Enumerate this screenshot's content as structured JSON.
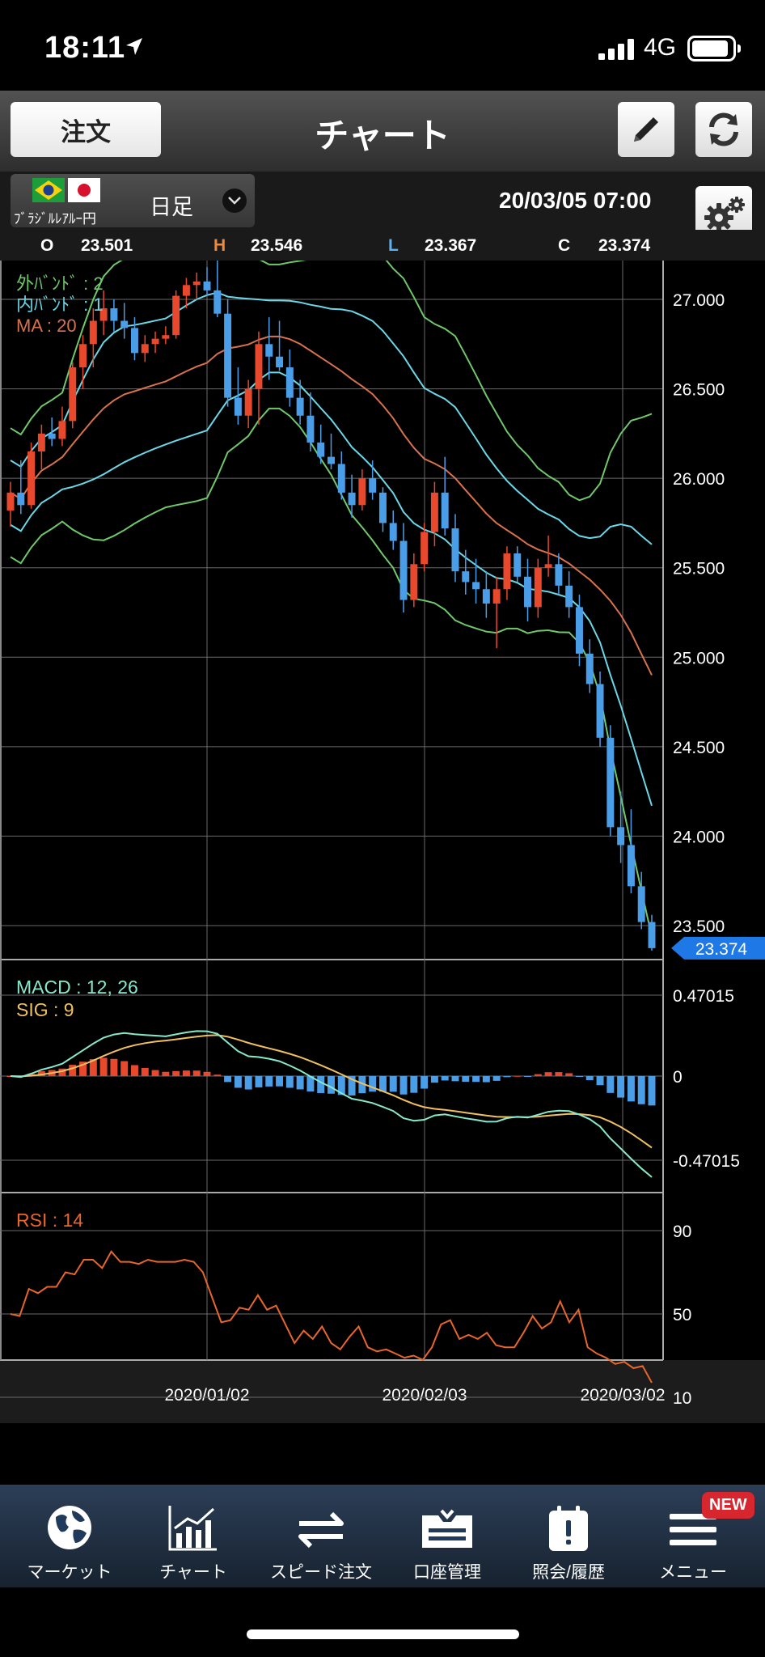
{
  "status_bar": {
    "time": "18:11",
    "network": "4G"
  },
  "toolbar": {
    "order_label": "注文",
    "title": "チャート"
  },
  "symbol": {
    "name": "ﾌﾞﾗｼﾞﾙﾚｱﾙｰ円",
    "period": "日足",
    "datetime": "20/03/05  07:00"
  },
  "ohlc": {
    "o_label": "O",
    "o_value": "23.501",
    "h_label": "H",
    "h_value": "23.546",
    "l_label": "L",
    "l_value": "23.367",
    "c_label": "C",
    "c_value": "23.374"
  },
  "colors": {
    "up": "#e8482c",
    "down": "#4a9ee8",
    "outer_band": "#6fc86a",
    "inner_band": "#6ad8e8",
    "ma": "#d8714e",
    "macd": "#88e8cc",
    "signal": "#f0c060",
    "rsi": "#e8652c",
    "grid": "#6a6a6a",
    "price_tag": "#1e78e6"
  },
  "chart_data": [
    {
      "type": "candlestick",
      "ylim": [
        23.374,
        27.2
      ],
      "y_ticks": [
        "27.000",
        "26.500",
        "26.000",
        "25.500",
        "25.000",
        "24.500",
        "24.000",
        "23.500"
      ],
      "x_tick_labels": [
        "2020/01/02",
        "2020/02/03",
        "2020/03/02"
      ],
      "current_price": "23.374",
      "legend": [
        "外ﾊﾞﾝﾄﾞ : 2",
        "内ﾊﾞﾝﾄﾞ : 1",
        "MA : 20"
      ],
      "candles": [
        {
          "o": 25.82,
          "h": 25.98,
          "l": 25.73,
          "c": 25.92
        },
        {
          "o": 25.92,
          "h": 26.1,
          "l": 25.8,
          "c": 25.85
        },
        {
          "o": 25.85,
          "h": 26.2,
          "l": 25.83,
          "c": 26.15
        },
        {
          "o": 26.15,
          "h": 26.3,
          "l": 26.05,
          "c": 26.25
        },
        {
          "o": 26.25,
          "h": 26.34,
          "l": 26.18,
          "c": 26.22
        },
        {
          "o": 26.22,
          "h": 26.4,
          "l": 26.18,
          "c": 26.32
        },
        {
          "o": 26.32,
          "h": 26.65,
          "l": 26.28,
          "c": 26.62
        },
        {
          "o": 26.62,
          "h": 26.8,
          "l": 26.5,
          "c": 26.75
        },
        {
          "o": 26.75,
          "h": 26.95,
          "l": 26.62,
          "c": 26.88
        },
        {
          "o": 26.88,
          "h": 27.05,
          "l": 26.8,
          "c": 26.95
        },
        {
          "o": 26.95,
          "h": 27.0,
          "l": 26.82,
          "c": 26.88
        },
        {
          "o": 26.88,
          "h": 26.98,
          "l": 26.78,
          "c": 26.84
        },
        {
          "o": 26.84,
          "h": 26.9,
          "l": 26.66,
          "c": 26.7
        },
        {
          "o": 26.7,
          "h": 26.8,
          "l": 26.65,
          "c": 26.75
        },
        {
          "o": 26.75,
          "h": 26.82,
          "l": 26.7,
          "c": 26.78
        },
        {
          "o": 26.78,
          "h": 26.85,
          "l": 26.75,
          "c": 26.8
        },
        {
          "o": 26.8,
          "h": 27.05,
          "l": 26.78,
          "c": 27.02
        },
        {
          "o": 27.02,
          "h": 27.12,
          "l": 26.95,
          "c": 27.08
        },
        {
          "o": 27.08,
          "h": 27.15,
          "l": 27.0,
          "c": 27.1
        },
        {
          "o": 27.1,
          "h": 27.18,
          "l": 27.02,
          "c": 27.05
        },
        {
          "o": 27.05,
          "h": 27.22,
          "l": 26.9,
          "c": 26.92
        },
        {
          "o": 26.92,
          "h": 27.0,
          "l": 26.4,
          "c": 26.45
        },
        {
          "o": 26.45,
          "h": 26.62,
          "l": 26.3,
          "c": 26.35
        },
        {
          "o": 26.35,
          "h": 26.55,
          "l": 26.28,
          "c": 26.5
        },
        {
          "o": 26.5,
          "h": 26.82,
          "l": 26.3,
          "c": 26.75
        },
        {
          "o": 26.75,
          "h": 26.9,
          "l": 26.55,
          "c": 26.68
        },
        {
          "o": 26.68,
          "h": 26.88,
          "l": 26.6,
          "c": 26.62
        },
        {
          "o": 26.62,
          "h": 26.72,
          "l": 26.4,
          "c": 26.45
        },
        {
          "o": 26.45,
          "h": 26.55,
          "l": 26.3,
          "c": 26.35
        },
        {
          "o": 26.35,
          "h": 26.48,
          "l": 26.15,
          "c": 26.2
        },
        {
          "o": 26.2,
          "h": 26.3,
          "l": 26.08,
          "c": 26.12
        },
        {
          "o": 26.12,
          "h": 26.25,
          "l": 26.05,
          "c": 26.08
        },
        {
          "o": 26.08,
          "h": 26.15,
          "l": 25.88,
          "c": 25.92
        },
        {
          "o": 25.92,
          "h": 26.02,
          "l": 25.78,
          "c": 25.85
        },
        {
          "o": 25.85,
          "h": 26.05,
          "l": 25.82,
          "c": 26.0
        },
        {
          "o": 26.0,
          "h": 26.1,
          "l": 25.88,
          "c": 25.92
        },
        {
          "o": 25.92,
          "h": 25.95,
          "l": 25.7,
          "c": 25.75
        },
        {
          "o": 25.75,
          "h": 25.82,
          "l": 25.6,
          "c": 25.65
        },
        {
          "o": 25.65,
          "h": 25.75,
          "l": 25.25,
          "c": 25.32
        },
        {
          "o": 25.32,
          "h": 25.58,
          "l": 25.28,
          "c": 25.52
        },
        {
          "o": 25.52,
          "h": 25.75,
          "l": 25.48,
          "c": 25.7
        },
        {
          "o": 25.7,
          "h": 25.98,
          "l": 25.62,
          "c": 25.92
        },
        {
          "o": 25.92,
          "h": 26.12,
          "l": 25.68,
          "c": 25.72
        },
        {
          "o": 25.72,
          "h": 25.8,
          "l": 25.42,
          "c": 25.48
        },
        {
          "o": 25.48,
          "h": 25.6,
          "l": 25.35,
          "c": 25.42
        },
        {
          "o": 25.42,
          "h": 25.55,
          "l": 25.3,
          "c": 25.38
        },
        {
          "o": 25.38,
          "h": 25.48,
          "l": 25.22,
          "c": 25.3
        },
        {
          "o": 25.3,
          "h": 25.45,
          "l": 25.05,
          "c": 25.38
        },
        {
          "o": 25.38,
          "h": 25.62,
          "l": 25.32,
          "c": 25.58
        },
        {
          "o": 25.58,
          "h": 25.62,
          "l": 25.42,
          "c": 25.45
        },
        {
          "o": 25.45,
          "h": 25.55,
          "l": 25.2,
          "c": 25.28
        },
        {
          "o": 25.28,
          "h": 25.55,
          "l": 25.22,
          "c": 25.5
        },
        {
          "o": 25.5,
          "h": 25.68,
          "l": 25.45,
          "c": 25.52
        },
        {
          "o": 25.52,
          "h": 25.58,
          "l": 25.35,
          "c": 25.4
        },
        {
          "o": 25.4,
          "h": 25.48,
          "l": 25.22,
          "c": 25.28
        },
        {
          "o": 25.28,
          "h": 25.35,
          "l": 24.95,
          "c": 25.02
        },
        {
          "o": 25.02,
          "h": 25.1,
          "l": 24.8,
          "c": 24.85
        },
        {
          "o": 24.85,
          "h": 24.92,
          "l": 24.5,
          "c": 24.55
        },
        {
          "o": 24.55,
          "h": 24.62,
          "l": 24.0,
          "c": 24.05
        },
        {
          "o": 24.05,
          "h": 24.25,
          "l": 23.85,
          "c": 23.95
        },
        {
          "o": 23.95,
          "h": 24.15,
          "l": 23.68,
          "c": 23.72
        },
        {
          "o": 23.72,
          "h": 23.8,
          "l": 23.48,
          "c": 23.52
        },
        {
          "o": 23.52,
          "h": 23.56,
          "l": 23.36,
          "c": 23.374
        }
      ]
    },
    {
      "type": "line",
      "legend": [
        "MACD : 12, 26",
        "SIG : 9"
      ],
      "y_ticks": [
        "0.47015",
        "0",
        "-0.47015"
      ],
      "ylim": [
        -0.47015,
        0.47015
      ]
    },
    {
      "type": "line",
      "legend": [
        "RSI : 14"
      ],
      "y_ticks": [
        "90",
        "50",
        "10"
      ],
      "ylim": [
        10,
        90
      ],
      "rsi": [
        50,
        49,
        62,
        60,
        63,
        63,
        70,
        69,
        76,
        76,
        72,
        80,
        75,
        75,
        74,
        76,
        75,
        75,
        75,
        76,
        75,
        70,
        58,
        46,
        47,
        53,
        52,
        59,
        52,
        54,
        45,
        36,
        42,
        38,
        44,
        36,
        33,
        39,
        44,
        34,
        32,
        33,
        31,
        29,
        30,
        28,
        34,
        45,
        47,
        38,
        40,
        38,
        41,
        35,
        34,
        34,
        41,
        49,
        43,
        46,
        56,
        46,
        52,
        34,
        31,
        29,
        26,
        27,
        24,
        25,
        17
      ]
    }
  ],
  "tab_bar": {
    "items": [
      {
        "label": "マーケット",
        "icon": "globe-icon"
      },
      {
        "label": "チャート",
        "icon": "chart-icon"
      },
      {
        "label": "スピード注文",
        "icon": "arrows-icon"
      },
      {
        "label": "口座管理",
        "icon": "account-icon"
      },
      {
        "label": "照会/履歴",
        "icon": "history-icon"
      },
      {
        "label": "メニュー",
        "icon": "menu-icon"
      }
    ],
    "new_badge": "NEW"
  }
}
